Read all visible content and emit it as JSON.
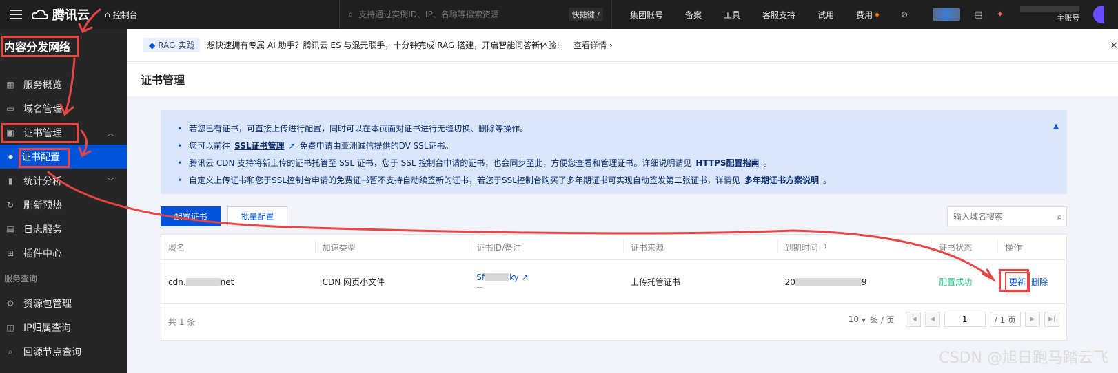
{
  "topbar": {
    "brand": "腾讯云",
    "console": "控制台",
    "search_placeholder": "支持通过实例ID、IP、名称等搜索资源",
    "shortcut": "快捷键 /",
    "nav": [
      "集团账号",
      "备案",
      "工具",
      "客服支持",
      "试用",
      "费用"
    ],
    "account_label": "主账号",
    "accent_dot_color": "#ff7200"
  },
  "sidebar": {
    "title": "内容分发网络",
    "items": [
      {
        "label": "服务概览",
        "icon": "grid-icon"
      },
      {
        "label": "域名管理",
        "icon": "domain-icon"
      },
      {
        "label": "证书管理",
        "icon": "certificate-icon"
      },
      {
        "label": "证书配置",
        "icon": "dot-icon"
      },
      {
        "label": "统计分析",
        "icon": "chart-icon"
      },
      {
        "label": "刷新预热",
        "icon": "refresh-icon"
      },
      {
        "label": "日志服务",
        "icon": "log-icon"
      },
      {
        "label": "插件中心",
        "icon": "plugin-icon"
      }
    ],
    "section": "服务查询",
    "query_items": [
      {
        "label": "资源包管理",
        "icon": "package-icon"
      },
      {
        "label": "IP归属查询",
        "icon": "ip-icon"
      },
      {
        "label": "回源节点查询",
        "icon": "search-icon"
      }
    ]
  },
  "banner": {
    "tag": "RAG 实践",
    "text": "想快速拥有专属 AI 助手？腾讯云 ES 与混元联手，十分钟完成 RAG 搭建，开启智能问答新体验!",
    "link": "查看详情 ›",
    "close": "×"
  },
  "page": {
    "title": "证书管理"
  },
  "notice": {
    "line1": "若您已有证书，可直接上传进行配置，同时可以在本页面对证书进行无缝切换、删除等操作。",
    "line2_pre": "您可以前往",
    "line2_link": "SSL证书管理",
    "line2_post": "免费申请由亚洲诚信提供的DV SSL证书。",
    "line3_pre": "腾讯云 CDN 支持将新上传的证书托管至 SSL 证书，您于 SSL 控制台申请的证书，也会同步至此，方便您查看和管理证书。详细说明请见",
    "line3_link": "HTTPS配置指南",
    "line3_post": "。",
    "line4_pre": "自定义上传证书和您于SSL控制台申请的免费证书暂不支持自动续签新的证书，若您于SSL控制台购买了多年期证书可实现自动签发第二张证书，详情见",
    "line4_link": "多年期证书方案说明",
    "line4_post": "。"
  },
  "toolbar": {
    "config_btn": "配置证书",
    "batch_btn": "批量配置",
    "search_placeholder": "输入域名搜索"
  },
  "table": {
    "headers": [
      "域名",
      "加速类型",
      "证书ID/备注",
      "证书来源",
      "到期时间",
      "证书状态",
      "操作"
    ],
    "row": {
      "domain_pre": "cdn.",
      "domain_post": "net",
      "type": "CDN 网页小文件",
      "cert_pre": "Sf",
      "cert_post": "ky",
      "cert_note": "--",
      "source": "上传托管证书",
      "expire_pre": "20",
      "expire_post": "9",
      "status": "配置成功",
      "op_renew": "更新",
      "op_delete": "删除"
    },
    "total": "共 1 条",
    "page_size": "10",
    "page_size_unit": "条 / 页",
    "current_page": "1",
    "total_pages": "/ 1 页"
  },
  "watermark": "CSDN @旭日跑马踏云飞",
  "colors": {
    "primary": "#0052d9",
    "annotation": "#e84545",
    "success": "#29cc85"
  }
}
